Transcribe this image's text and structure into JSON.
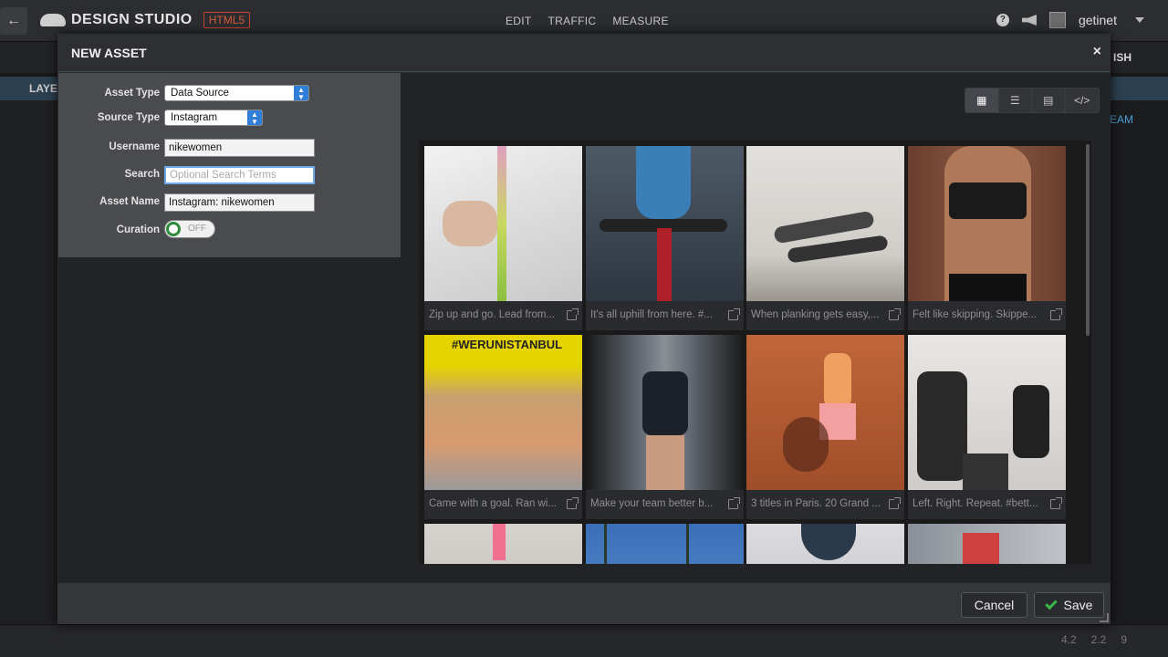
{
  "app": {
    "back_icon": "arrow-left-icon",
    "logo_text": "DESIGN STUDIO",
    "logo_badge": "HTML5",
    "nav": [
      "EDIT",
      "TRAFFIC",
      "MEASURE"
    ],
    "user": "getinet"
  },
  "background": {
    "layers_label": "LAYE",
    "stream_label": "EAM",
    "publish_label": "ISH",
    "status": [
      "4.2",
      "2.2",
      "9"
    ]
  },
  "modal": {
    "title": "NEW ASSET",
    "close": "×",
    "form": {
      "asset_type_label": "Asset Type",
      "asset_type_value": "Data Source",
      "source_type_label": "Source Type",
      "source_type_value": "Instagram",
      "username_label": "Username",
      "username_value": "nikewomen",
      "search_label": "Search",
      "search_placeholder": "Optional Search Terms",
      "asset_name_label": "Asset Name",
      "asset_name_value": "Instagram: nikewomen",
      "curation_label": "Curation",
      "curation_value": "OFF"
    },
    "view_tabs": [
      "grid-view-icon",
      "list-view-icon",
      "card-view-icon",
      "code-view-icon"
    ],
    "cards": [
      {
        "caption": "Zip up and go. Lead from...",
        "color": "#d9d9d9"
      },
      {
        "caption": "It's all uphill from here. #...",
        "color": "#3c4552"
      },
      {
        "caption": "When planking gets easy,...",
        "color": "#c9c6c0"
      },
      {
        "caption": "Felt like skipping. Skippe...",
        "color": "#5a3d32"
      },
      {
        "caption": "Came with a goal. Ran wi...",
        "color": "#b7a36a"
      },
      {
        "caption": "Make your team better b...",
        "color": "#3e4652"
      },
      {
        "caption": "3 titles in Paris. 20 Grand ...",
        "color": "#b55a34"
      },
      {
        "caption": "Left. Right. Repeat. #bett...",
        "color": "#d8d4d0"
      },
      {
        "caption": "",
        "color": "#c8c4c0"
      },
      {
        "caption": "",
        "color": "#4b7cc0"
      },
      {
        "caption": "",
        "color": "#d0d0d4"
      },
      {
        "caption": "",
        "color": "#a8b0b8"
      }
    ],
    "cancel_label": "Cancel",
    "save_label": "Save"
  }
}
